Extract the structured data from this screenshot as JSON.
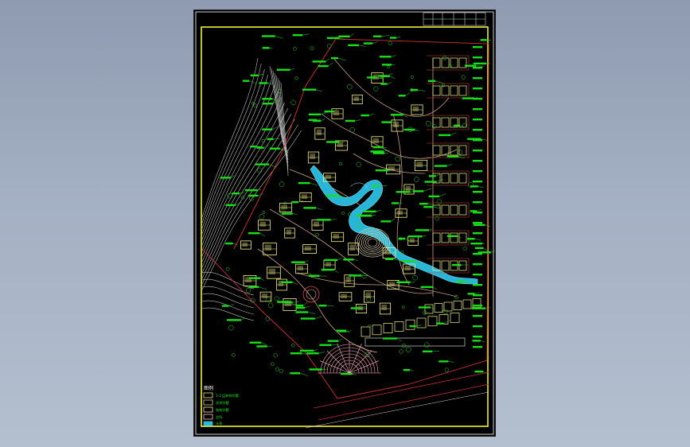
{
  "drawing": {
    "legend": {
      "title": "图例",
      "items": [
        {
          "label": "1-3 层联排别墅",
          "color": "#e8e07a"
        },
        {
          "label": "双拼别墅",
          "color": "#d8d070"
        },
        {
          "label": "独栋别墅",
          "color": "#f2ec8e"
        },
        {
          "label": "会所",
          "color": "#ffb8c8"
        },
        {
          "label": "水系",
          "color": "#2fb8d8"
        }
      ]
    },
    "colors": {
      "background": "#000000",
      "frame": "#ffff3a",
      "road": "#c83030",
      "annotation": "#18e018",
      "building": "#f5ee8a",
      "water": "#30c0e0",
      "contour": "#b8b8b8"
    }
  }
}
